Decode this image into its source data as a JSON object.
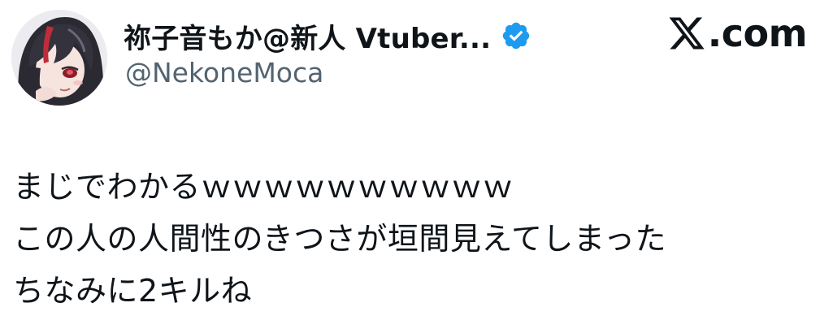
{
  "author": {
    "display_name": "祢子音もか@新人 Vtuber...",
    "handle": "@NekoneMoca",
    "verified": true,
    "verified_color": "#1d9bf0",
    "avatar_icon": "avatar-illustration-dark-hair-red-eyes"
  },
  "brand": {
    "icon": "x-logo-icon",
    "label": ".com"
  },
  "tweet": {
    "lines": [
      "まじでわかるｗｗｗｗｗｗｗｗｗｗ",
      "この人の人間性のきつさが垣間見えてしまった",
      "ちなみに2キルね"
    ]
  },
  "colors": {
    "text": "#0f1419",
    "secondary_text": "#536471",
    "background": "#ffffff"
  }
}
